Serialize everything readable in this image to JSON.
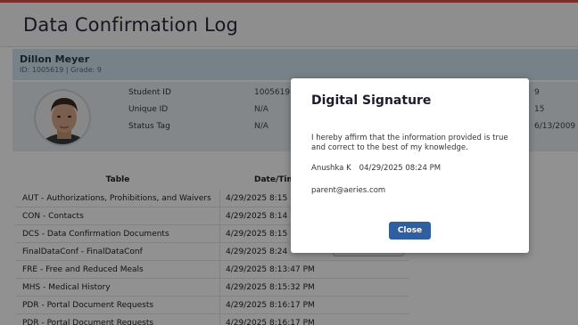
{
  "page": {
    "title": "Data Confirmation Log"
  },
  "student": {
    "name": "Dillon Meyer",
    "meta": "ID: 1005619 |  Grade: 9",
    "fields": [
      {
        "label": "Student ID",
        "value": "1005619"
      },
      {
        "label": "Unique ID",
        "value": "N/A"
      },
      {
        "label": "Status Tag",
        "value": "N/A"
      }
    ],
    "right_values": [
      "9",
      "15",
      "6/13/2009"
    ]
  },
  "table": {
    "headers": [
      "Table",
      "Date/Time"
    ],
    "rows": [
      {
        "table": "AUT - Authorizations, Prohibitions, and Waivers",
        "datetime": "4/29/2025 8:15"
      },
      {
        "table": "CON - Contacts",
        "datetime": "4/29/2025 8:14"
      },
      {
        "table": "DCS - Data Confirmation Documents",
        "datetime": "4/29/2025 8:15"
      },
      {
        "table": "FinalDataConf - FinalDataConf",
        "datetime": "4/29/2025 8:24"
      },
      {
        "table": "FRE - Free and Reduced Meals",
        "datetime": "4/29/2025 8:13:47 PM"
      },
      {
        "table": "MHS - Medical History",
        "datetime": "4/29/2025 8:15:32 PM"
      },
      {
        "table": "PDR - Portal Document Requests",
        "datetime": "4/29/2025 8:16:17 PM"
      },
      {
        "table": "PDR - Portal Document Requests",
        "datetime": "4/29/2025 8:16:17 PM"
      }
    ]
  },
  "modal": {
    "title": "Digital Signature",
    "affirmation": "I hereby affirm that the information provided is true and correct to the best of my knowledge.",
    "signer": "Anushka K",
    "signed_at": "04/29/2025 08:24 PM",
    "email": "parent@aeries.com",
    "close_label": "Close"
  },
  "colors": {
    "accent": "#2f5f9f",
    "student_band": "#cfe3f0",
    "overlay": "rgba(0,0,0,0.43)"
  }
}
